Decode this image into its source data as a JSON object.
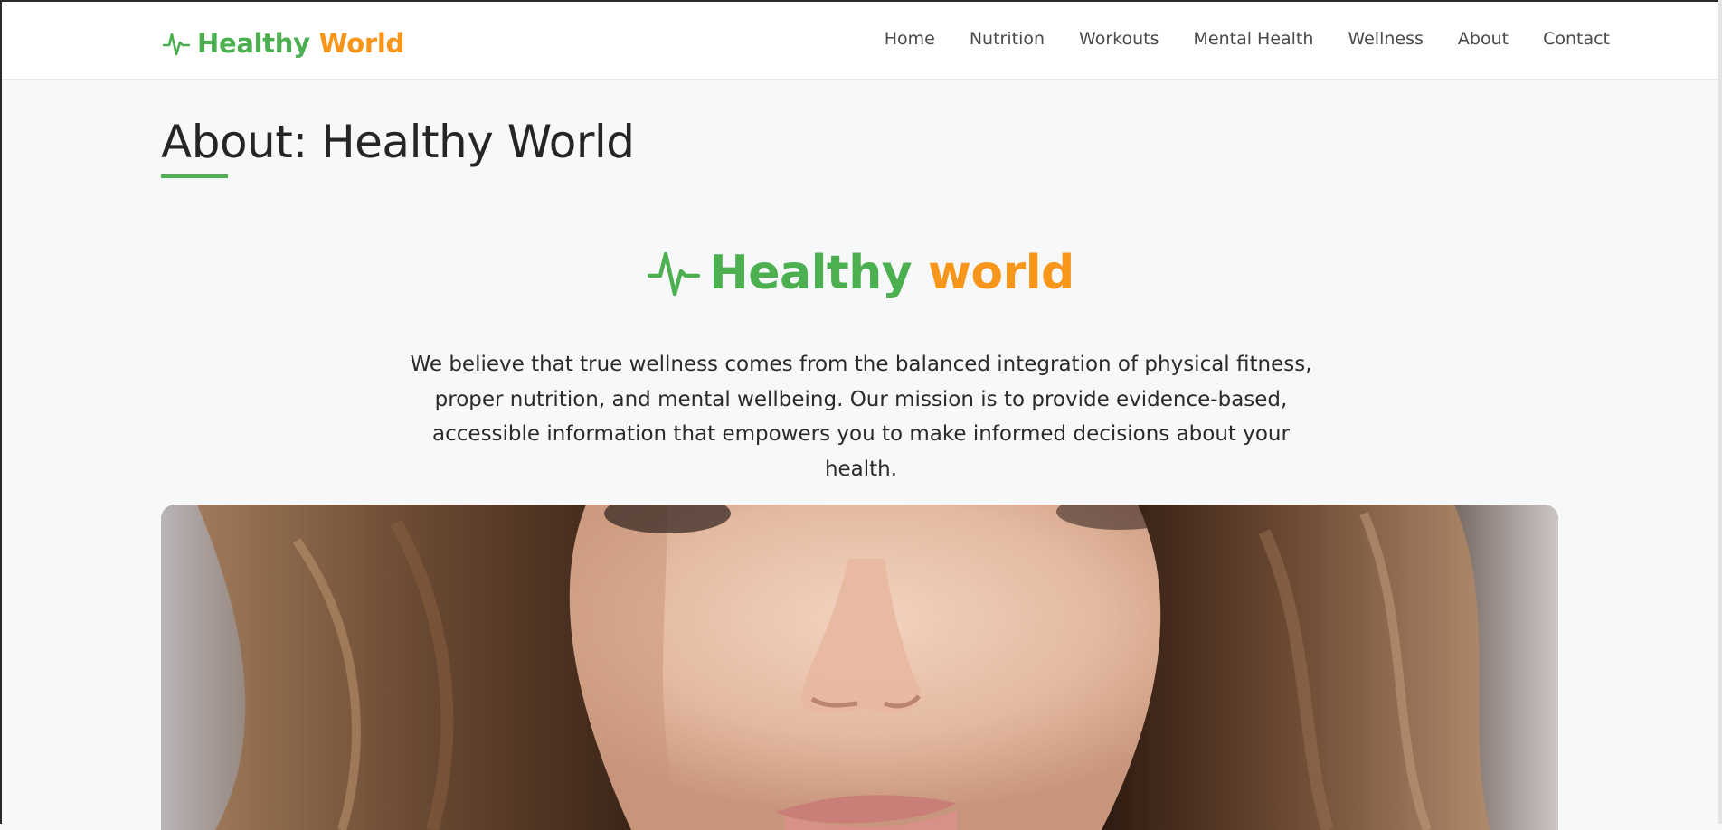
{
  "header": {
    "brand": {
      "word1": "Healthy",
      "word2": "World",
      "icon": "heartbeat-icon"
    },
    "nav": [
      {
        "label": "Home"
      },
      {
        "label": "Nutrition"
      },
      {
        "label": "Workouts"
      },
      {
        "label": "Mental Health"
      },
      {
        "label": "Wellness"
      },
      {
        "label": "About"
      },
      {
        "label": "Contact"
      }
    ]
  },
  "page": {
    "title": "About: Healthy World"
  },
  "hero": {
    "logo": {
      "word1": "Healthy",
      "word2": "world",
      "icon": "heartbeat-icon"
    },
    "mission": "We believe that true wellness comes from the balanced integration of physical fitness, proper nutrition, and mental wellbeing. Our mission is to provide evidence-based, accessible information that empowers you to make informed decisions about your health.",
    "image": "woman-portrait-photo"
  },
  "colors": {
    "accent_green": "#4caf50",
    "accent_orange": "#f7961b",
    "background": "#f7f8f9",
    "navbar": "#ffffff"
  }
}
